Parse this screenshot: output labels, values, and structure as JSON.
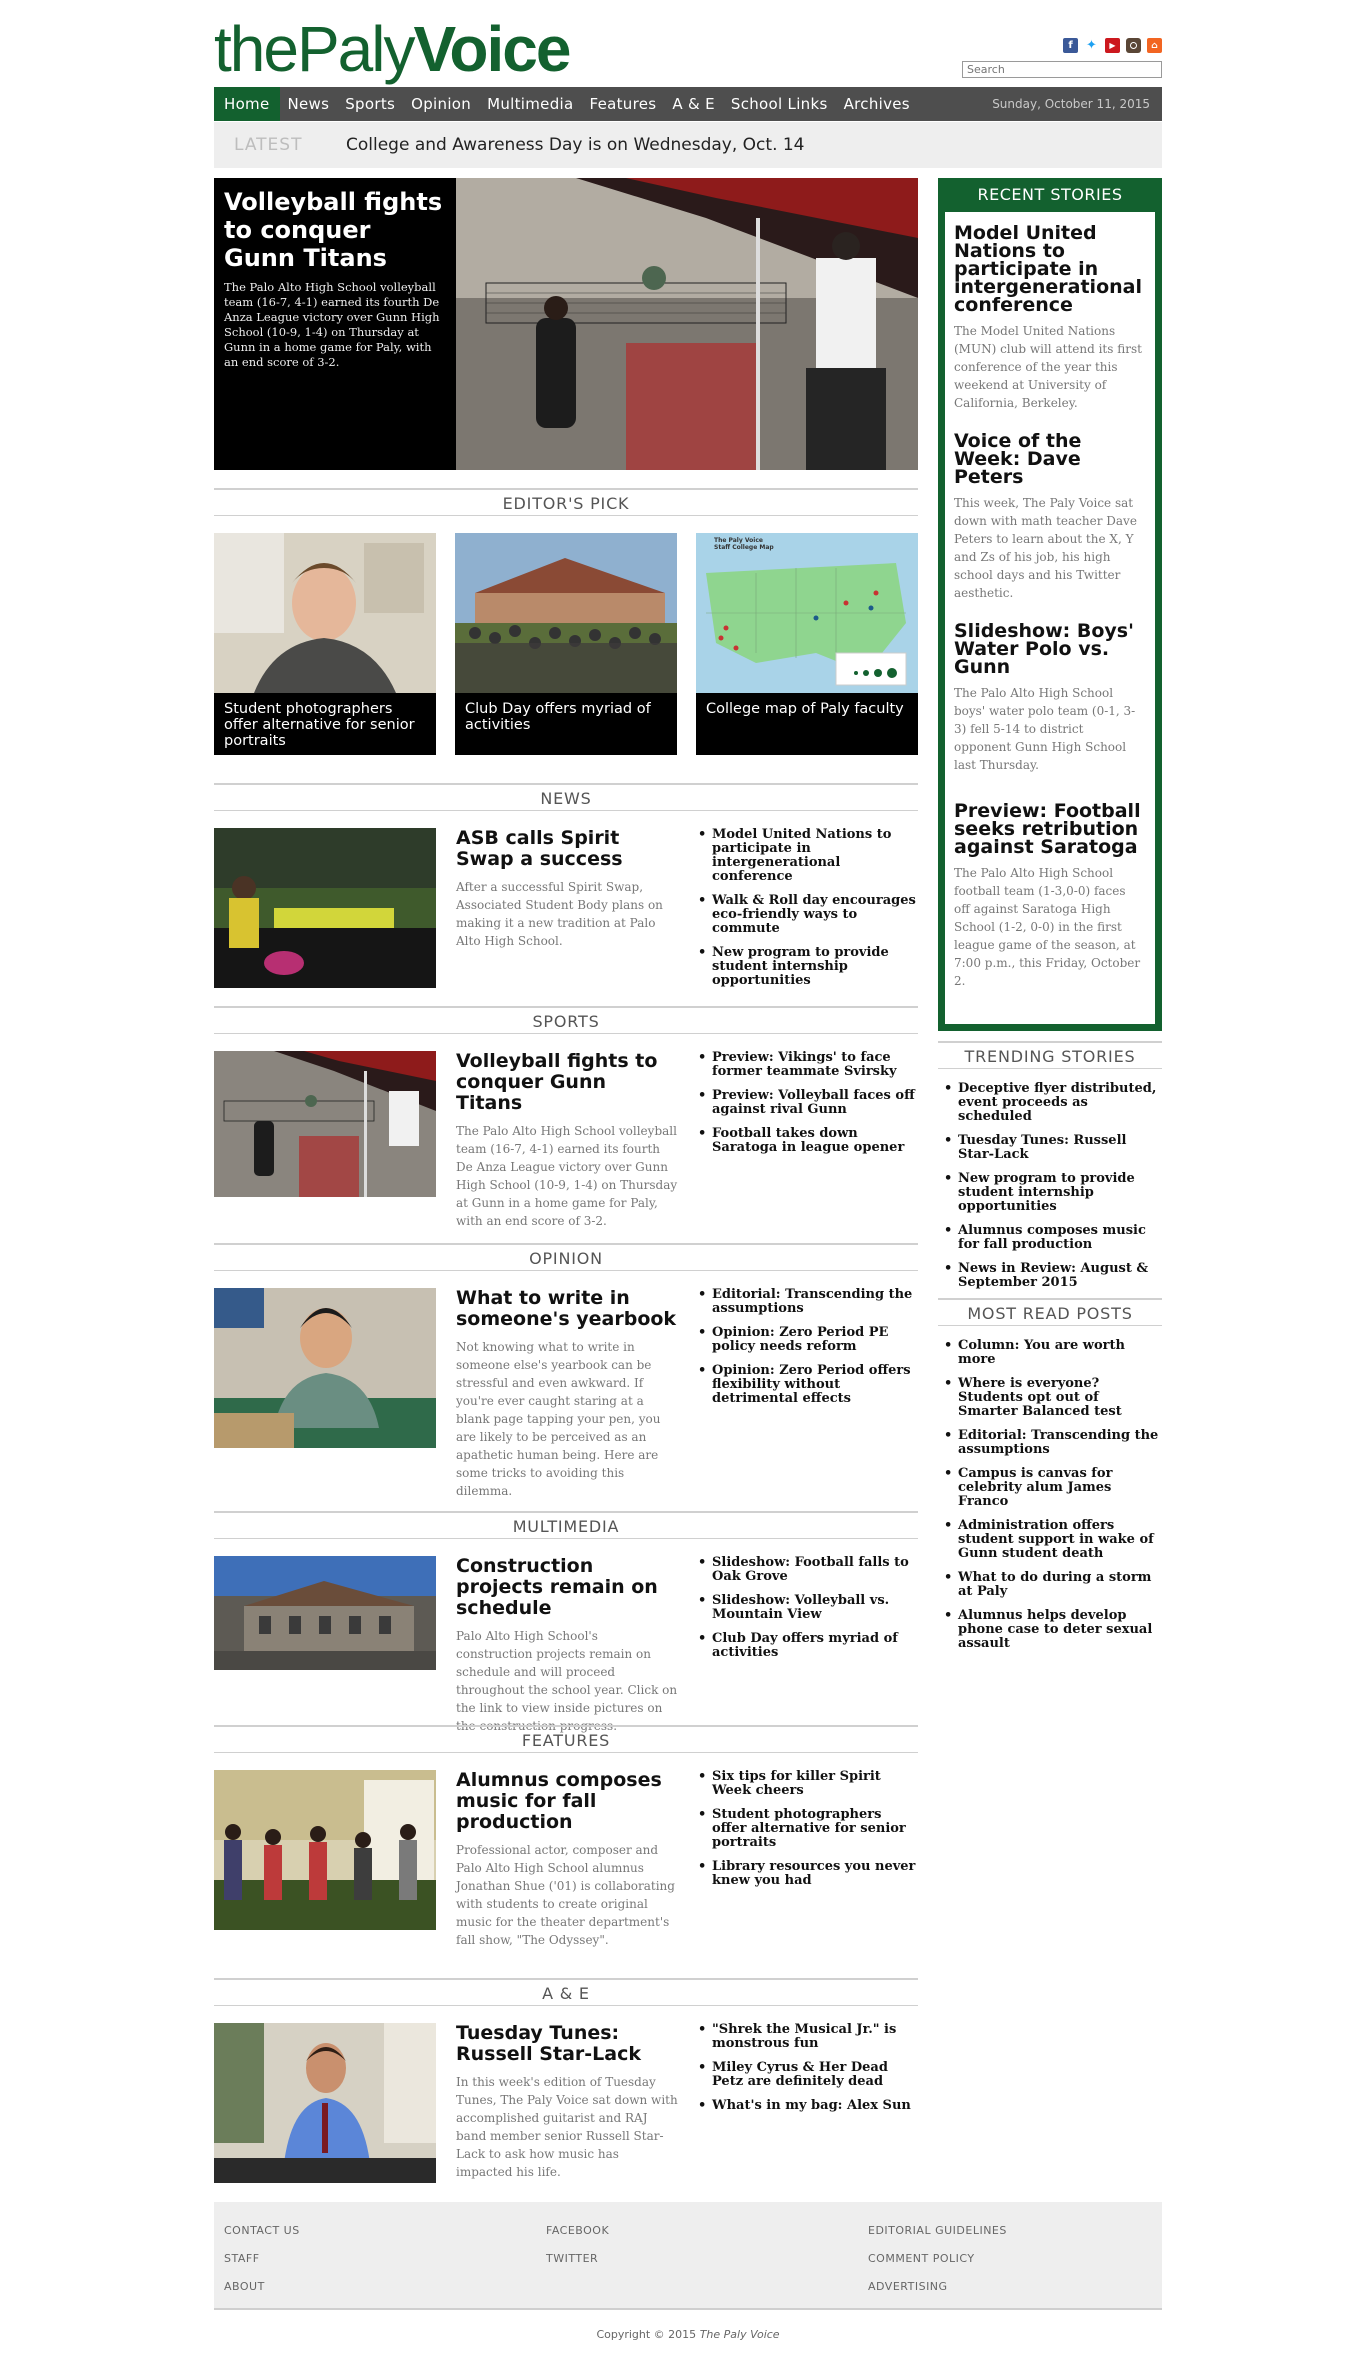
{
  "brand": {
    "part1": "the",
    "part2": "Paly",
    "part3": "Voice",
    "color": "#13612f"
  },
  "search": {
    "placeholder": "Search"
  },
  "social": [
    "facebook-icon",
    "twitter-icon",
    "youtube-icon",
    "instagram-icon",
    "rss-icon"
  ],
  "nav": {
    "items": [
      "Home",
      "News",
      "Sports",
      "Opinion",
      "Multimedia",
      "Features",
      "A & E",
      "School Links",
      "Archives"
    ],
    "date": "Sunday, October 11, 2015"
  },
  "latest": {
    "tag": "LATEST",
    "text": "College and Awareness Day is on Wednesday, Oct. 14"
  },
  "hero": {
    "title": "Volleyball fights to conquer Gunn Titans",
    "summary": "The Palo Alto High School volleyball team (16-7, 4-1) earned its fourth De Anza League victory over Gunn High School (10-9, 1-4) on Thursday at Gunn in a home game for Paly, with an end score of 3-2."
  },
  "editors_pick": {
    "heading": "EDITOR'S PICK",
    "items": [
      "Student photographers offer alternative for senior portraits",
      "Club Day offers myriad of activities",
      "College map of Paly faculty"
    ],
    "map_title": "The Paly Voice Staff College Map"
  },
  "sections": [
    {
      "heading": "NEWS",
      "title": "ASB calls Spirit Swap a success",
      "summary": "After a successful Spirit Swap, Associated Student Body plans on making it a new tradition at Palo Alto High School.",
      "links": [
        "Model United Nations to participate in intergenerational conference",
        "Walk & Roll day encourages eco-friendly ways to commute",
        "New program to provide student internship opportunities"
      ]
    },
    {
      "heading": "SPORTS",
      "title": "Volleyball fights to conquer Gunn Titans",
      "summary": "The Palo Alto High School volleyball team (16-7, 4-1) earned its fourth De Anza League victory over Gunn High School (10-9, 1-4) on Thursday at Gunn in a home game for Paly, with an end score of 3-2.",
      "links": [
        "Preview: Vikings' to face former teammate Svirsky",
        "Preview: Volleyball faces off against rival Gunn",
        "Football takes down Saratoga in league opener"
      ]
    },
    {
      "heading": "OPINION",
      "title": "What to write in someone's yearbook",
      "summary": "Not knowing what to write in someone else's yearbook can be stressful and even awkward. If you're ever caught staring at a blank page tapping your pen, you are likely to be perceived as an apathetic human being. Here are some tricks to avoiding this dilemma.",
      "links": [
        "Editorial: Transcending the assumptions",
        "Opinion: Zero Period PE policy needs reform",
        "Opinion: Zero Period offers flexibility without detrimental effects"
      ]
    },
    {
      "heading": "MULTIMEDIA",
      "title": "Construction projects remain on schedule",
      "summary": "Palo Alto High School's construction projects remain on schedule and will proceed throughout the school year. Click on the link to view inside pictures on the construction progress.",
      "links": [
        "Slideshow: Football falls to Oak Grove",
        "Slideshow: Volleyball vs. Mountain View",
        "Club Day offers myriad of activities"
      ]
    },
    {
      "heading": "FEATURES",
      "title": "Alumnus composes music for fall production",
      "summary": "Professional actor, composer and Palo Alto High School alumnus Jonathan Shue ('01) is collaborating with students to create original music for the theater department's fall show, \"The Odyssey\".",
      "links": [
        "Six tips for killer Spirit Week cheers",
        "Student photographers offer alternative for senior portraits",
        "Library resources you never knew you had"
      ]
    },
    {
      "heading": "A & E",
      "title": "Tuesday Tunes: Russell Star-Lack",
      "summary": "In this week's edition of Tuesday Tunes, The Paly Voice sat down with accomplished guitarist and RAJ band member senior Russell Star-Lack to ask how music has impacted his life.",
      "links": [
        "\"Shrek the Musical Jr.\" is monstrous fun",
        "Miley Cyrus & Her Dead Petz are definitely dead",
        "What's in my bag: Alex Sun"
      ]
    }
  ],
  "recent": {
    "heading": "RECENT STORIES",
    "items": [
      {
        "title": "Model United Nations to participate in intergenerational conference",
        "summary": "The Model United Nations (MUN) club will attend its first conference of the year this weekend at University of California, Berkeley."
      },
      {
        "title": "Voice of the Week: Dave Peters",
        "summary": "This week, The Paly Voice sat down with math teacher Dave Peters to learn about the X, Y and Zs of his job, his high school days and his Twitter aesthetic."
      },
      {
        "title": "Slideshow: Boys' Water Polo vs. Gunn",
        "summary": "The Palo Alto High School boys' water polo team (0-1, 3-3) fell 5-14 to district opponent Gunn High School last Thursday."
      },
      {
        "title": "Preview: Football seeks retribution against Saratoga",
        "summary": "The Palo Alto High School football team (1-3,0-0) faces off against Saratoga High School (1-2, 0-0) in the first league game of the season, at 7:00 p.m., this Friday, October 2."
      }
    ]
  },
  "trending": {
    "heading": "TRENDING STORIES",
    "items": [
      "Deceptive flyer distributed, event proceeds as scheduled",
      "Tuesday Tunes: Russell Star-Lack",
      "New program to provide student internship opportunities",
      "Alumnus composes music for fall production",
      "News in Review: August & September 2015"
    ]
  },
  "most_read": {
    "heading": "MOST READ POSTS",
    "items": [
      "Column: You are worth more",
      "Where is everyone? Students opt out of Smarter Balanced test",
      "Editorial: Transcending the assumptions",
      "Campus is canvas for celebrity alum James Franco",
      "Administration offers student support in wake of Gunn student death",
      "What to do during a storm at Paly",
      "Alumnus helps develop phone case to deter sexual assault"
    ]
  },
  "footer": {
    "col1": [
      "CONTACT US",
      "STAFF",
      "ABOUT"
    ],
    "col2": [
      "FACEBOOK",
      "TWITTER"
    ],
    "col3": [
      "EDITORIAL GUIDELINES",
      "COMMENT POLICY",
      "ADVERTISING"
    ],
    "copyright": "Copyright © 2015",
    "copyright_name": "The Paly Voice"
  }
}
